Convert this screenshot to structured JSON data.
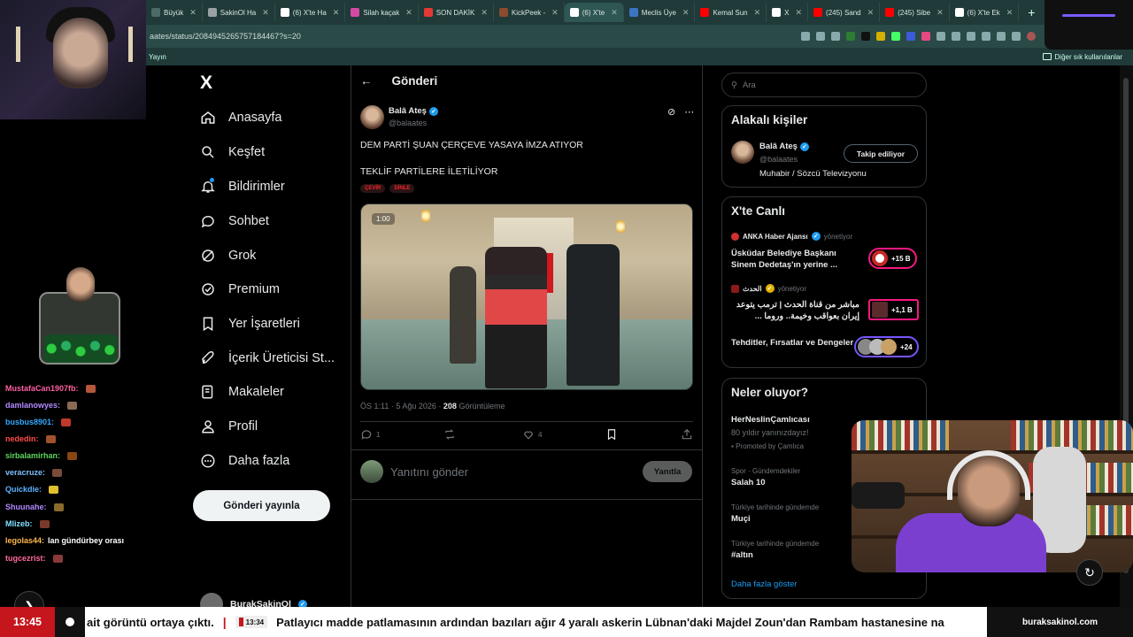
{
  "browser": {
    "tabs": [
      {
        "label": "Büyük",
        "color": "#4a6b68"
      },
      {
        "label": "SakinOl Ha",
        "color": "#9aa0a6"
      },
      {
        "label": "(6) X'te Ha",
        "color": "#ffffff"
      },
      {
        "label": "Silah kaçak",
        "color": "#d44aa3"
      },
      {
        "label": "SON DAKİK",
        "color": "#e53935"
      },
      {
        "label": "KickPeek -",
        "color": "#8a4b2e"
      },
      {
        "label": "(6) X'te",
        "color": "#ffffff",
        "active": true
      },
      {
        "label": "Meclis Üye",
        "color": "#3b74c2"
      },
      {
        "label": "Kemal Sun",
        "color": "#ff0000"
      },
      {
        "label": "X",
        "color": "#ffffff"
      },
      {
        "label": "(245) Sand",
        "color": "#ff0000"
      },
      {
        "label": "(245) Sibe",
        "color": "#ff0000"
      },
      {
        "label": "(6) X'te Ek",
        "color": "#ffffff"
      }
    ],
    "new_tab": "+",
    "url": "aates/status/2084945265757184467?s=20",
    "bookmark_left": "Yayın",
    "bookmark_right": "Diğer sık kullanılanlar"
  },
  "nav": {
    "logo": "X",
    "items": [
      {
        "label": "Anasayfa",
        "icon": "home-icon"
      },
      {
        "label": "Keşfet",
        "icon": "search-icon"
      },
      {
        "label": "Bildirimler",
        "icon": "bell-icon"
      },
      {
        "label": "Sohbet",
        "icon": "chat-icon"
      },
      {
        "label": "Grok",
        "icon": "grok-icon"
      },
      {
        "label": "Premium",
        "icon": "premium-icon"
      },
      {
        "label": "Yer İşaretleri",
        "icon": "bookmark-icon"
      },
      {
        "label": "İçerik Üreticisi St...",
        "icon": "rocket-icon"
      },
      {
        "label": "Makaleler",
        "icon": "article-icon"
      },
      {
        "label": "Profil",
        "icon": "profile-icon"
      },
      {
        "label": "Daha fazla",
        "icon": "more-icon"
      }
    ],
    "post_button": "Gönderi yayınla",
    "account_name": "BurakSakinOl"
  },
  "post": {
    "header": "Gönderi",
    "author_name": "Balâ Ateş",
    "author_handle": "@balaates",
    "text": "DEM PARTİ ŞUAN ÇERÇEVE YASAYA İMZA ATIYOR\n\nTEKLİF PARTİLERE İLETİLİYOR",
    "translate_label": "ÇEVİR",
    "listen_label": "DİNLE",
    "video_duration": "1:00",
    "timestamp": "ÖS 1:11 · 5 Ağu 2026 · ",
    "views_count": "208",
    "views_label": "Görüntüleme",
    "replies": "1",
    "reposts": "",
    "likes": "4",
    "reply_placeholder": "Yanıtını gönder",
    "reply_button": "Yanıtla"
  },
  "sidebar": {
    "search_placeholder": "Ara",
    "related_title": "Alakalı kişiler",
    "related": {
      "name": "Balâ Ateş",
      "handle": "@balaates",
      "bio": "Muhabir / Sözcü Televizyonu",
      "follow_label": "Takip ediliyor"
    },
    "live_title": "X'te Canlı",
    "live": [
      {
        "source": "ANKA Haber Ajansı",
        "role": "yönetiyor",
        "title": "Üsküdar Belediye Başkanı Sinem Dedetaş'ın yerine ...",
        "count": "+15 B"
      },
      {
        "source": "الحدث",
        "role": "yönetiyor",
        "title": "مباشر من قناة الحدث | ترمب يتوعد إيران بعواقب وخيمة.. وروما ...",
        "count": "+1,1 B"
      },
      {
        "source": "",
        "role": "",
        "title": "Tehditler, Fırsatlar ve Dengeler",
        "count": "+24"
      }
    ],
    "trends_title": "Neler oluyor?",
    "promo_name": "HerNeslinÇamlıcası",
    "promo_desc": "80 yıldır yanınızdayız!",
    "promo_by": "Promoted by Çamlıca",
    "trends": [
      {
        "category": "Spor · Gündemdekiler",
        "name": "Salah 10"
      },
      {
        "category": "Türkiye tarihinde gündemde",
        "name": "Muçi"
      },
      {
        "category": "Türkiye tarihinde gündemde",
        "name": "#altın"
      }
    ],
    "show_more": "Daha fazla göster"
  },
  "chat": [
    {
      "user": "MustafaCan1907fb:",
      "color": "#ff5fa2",
      "msg": ""
    },
    {
      "user": "damlanowyes:",
      "color": "#b28bff",
      "msg": ""
    },
    {
      "user": "busbus8901:",
      "color": "#34a7ff",
      "msg": ""
    },
    {
      "user": "nededin:",
      "color": "#ff4d4d",
      "msg": ""
    },
    {
      "user": "sirbalamirhan:",
      "color": "#5cd65c",
      "msg": ""
    },
    {
      "user": "veracruze:",
      "color": "#7fbfff",
      "msg": ""
    },
    {
      "user": "Quickdie:",
      "color": "#5fb2ff",
      "msg": ""
    },
    {
      "user": "Shuunahe:",
      "color": "#b088ff",
      "msg": ""
    },
    {
      "user": "Mlizeb:",
      "color": "#7ee0ff",
      "msg": ""
    },
    {
      "user": "legolas44:",
      "color": "#ffb84d",
      "msg": "lan gündürbey orası"
    },
    {
      "user": "tugcezrist:",
      "color": "#ff6b9a",
      "msg": ""
    }
  ],
  "ticker": {
    "time": "13:45",
    "text_a": "ait görüntü ortaya çıktı.",
    "stamp": "13:34",
    "text_b": "Patlayıcı madde patlamasının ardından bazıları ağır 4 yaralı askerin Lübnan'daki Majdel Zoun'dan Rambam hastanesine na",
    "brand": "buraksakinol.com"
  }
}
